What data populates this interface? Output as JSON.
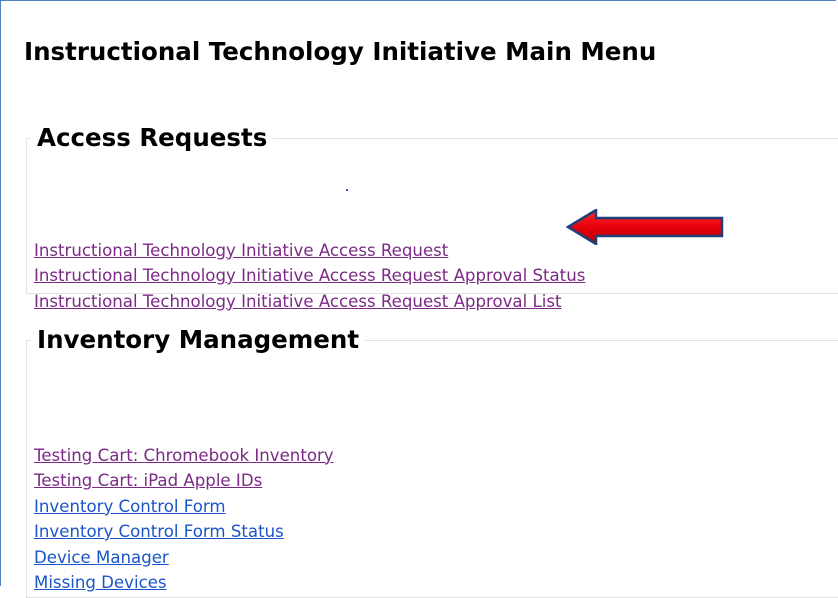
{
  "page": {
    "title": "Instructional Technology Initiative Main Menu"
  },
  "sections": {
    "access_requests": {
      "legend": "Access Requests",
      "links": [
        {
          "label": "Instructional Technology Initiative Access Request",
          "state": "visited"
        },
        {
          "label": "Instructional Technology Initiative Access Request Approval Status",
          "state": "visited"
        },
        {
          "label": "Instructional Technology Initiative Access Request Approval List",
          "state": "visited"
        }
      ]
    },
    "inventory_management": {
      "legend": "Inventory Management",
      "links": [
        {
          "label": "Testing Cart: Chromebook Inventory",
          "state": "visited"
        },
        {
          "label": "Testing Cart: iPad Apple IDs",
          "state": "visited"
        },
        {
          "label": "Inventory Control Form",
          "state": "unvisited"
        },
        {
          "label": "Inventory Control Form Status",
          "state": "unvisited"
        },
        {
          "label": "Device Manager",
          "state": "unvisited"
        },
        {
          "label": "Missing Devices",
          "state": "unvisited"
        }
      ]
    }
  },
  "annotation": {
    "icon": "left-arrow-icon",
    "color": "#e8000b"
  },
  "colors": {
    "visited_link": "#7b2a86",
    "unvisited_link": "#1a55c9",
    "frame_border": "#4f81bd"
  }
}
